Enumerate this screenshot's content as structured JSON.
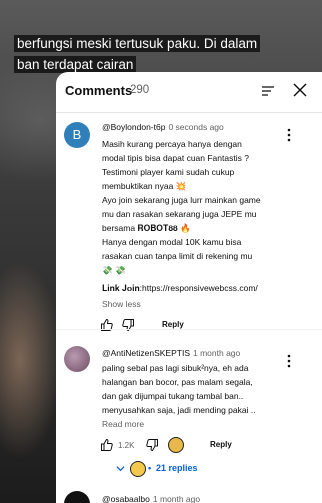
{
  "video": {
    "caption_line1": "berfungsi meski tertusuk paku. Di dalam",
    "caption_line2": "ban terdapat cairan"
  },
  "panel": {
    "title": "Comments",
    "count": "290",
    "icons": [
      "sort-icon",
      "close-icon"
    ]
  },
  "comments": [
    {
      "avatar_letter": "B",
      "avatar_color": "#2f7fb8",
      "author": "@Boylondon-t6p",
      "time": "0 seconds ago",
      "lines": [
        "Masih kurang percaya hanya dengan",
        "modal tipis bisa dapat cuan Fantastis ?",
        "Testimoni player kami sudah cukup",
        "membuktikan nyaa 💥",
        "Ayo join sekarang juga lurr mainkan game",
        "mu dan rasakan sekarang juga JEPE mu",
        "bersama 𝐑𝐎𝐁𝐎𝐓𝟖𝟖 🔥",
        "Hanya dengan modal 10K kamu bisa",
        "rasakan cuan tanpa limit di rekening mu",
        "💸 💸"
      ],
      "link_label": "𝐋𝐢𝐧𝐤 𝐉𝐨𝐢𝐧:",
      "link_url": "https://responsivewebcss.com/",
      "show_less": "Show less",
      "reply": "Reply"
    },
    {
      "author": "@AntiNetizenSKEPTIS",
      "time": "1 month ago",
      "lines": [
        "paling sebal pas lagi sibuk²nya, eh ada",
        "halangan ban bocor, pas malam segala,",
        "dan gak dijumpai tukang tambal ban..",
        "menyusahkan saja, jadi mending pakai .."
      ],
      "read_more": "Read more",
      "likes": "1.2K",
      "reply": "Reply",
      "replies": "21 replies"
    },
    {
      "author": "@osabaalbo",
      "time": "1 month ago"
    }
  ]
}
